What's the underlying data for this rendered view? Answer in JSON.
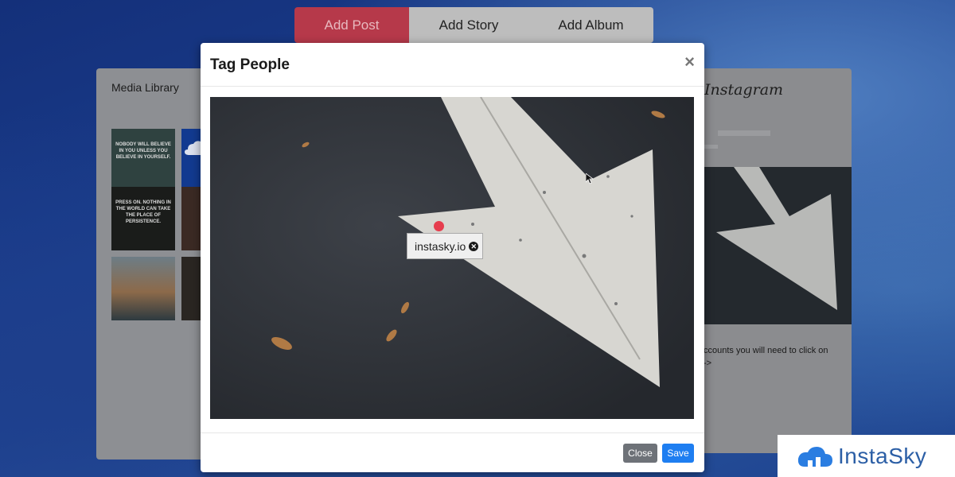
{
  "tabs": [
    {
      "label": "Add Post",
      "active": true
    },
    {
      "label": "Add Story",
      "active": false
    },
    {
      "label": "Add Album",
      "active": false
    }
  ],
  "media_library": {
    "title": "Media Library",
    "thumbnails": [
      {
        "text": "NOBODY WILL BELIEVE IN YOU UNLESS YOU BELIEVE IN YOURSELF."
      },
      {
        "text": ""
      },
      {
        "text": "PRESS ON. NOTHING IN THE WORLD CAN TAKE THE PLACE OF PERSISTENCE."
      },
      {
        "text": ""
      },
      {
        "text": ""
      },
      {
        "text": ""
      }
    ]
  },
  "preview": {
    "title": "Instagram",
    "text": "ccounts you will need to click on\n->"
  },
  "modal": {
    "title": "Tag People",
    "close_symbol": "×",
    "tag_label": "instasky.io",
    "tag_remove_symbol": "✕",
    "buttons": {
      "close": "Close",
      "save": "Save"
    }
  },
  "brand": {
    "name": "InstaSky"
  },
  "colors": {
    "active_tab": "#b6394a",
    "save_button": "#1e7ef1",
    "close_button": "#6e7278",
    "tag_dot": "#e63d4e",
    "brand": "#2c5fa6"
  }
}
